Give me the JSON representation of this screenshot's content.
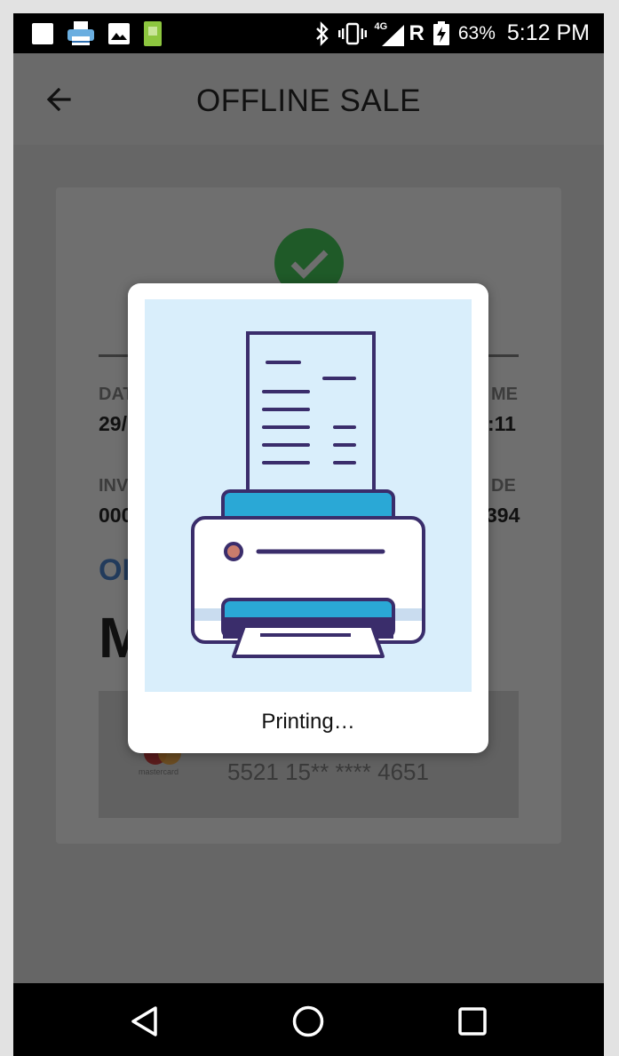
{
  "status_bar": {
    "battery_percent": "63%",
    "time": "5:12 PM",
    "network_label": "4G",
    "roaming_label": "R",
    "left_icons": [
      "notification-square-icon",
      "printer-notification-icon",
      "image-notification-icon",
      "app-notification-icon"
    ],
    "right_icons": [
      "bluetooth-icon",
      "vibrate-icon",
      "signal-icon",
      "battery-charging-icon"
    ]
  },
  "app_bar": {
    "title": "OFFLINE SALE",
    "back_icon": "arrow-left-icon"
  },
  "receipt": {
    "date_label": "DAT",
    "date_value": "29/",
    "time_label": "ME",
    "time_value": ":11",
    "invoice_label": "INV",
    "invoice_value": "000",
    "code_label": "DE",
    "code_value": "394",
    "type_partial": "OI",
    "amount_partial": "M",
    "card_brand": "mastercard",
    "card_number": "5521 15** **** 4651"
  },
  "dialog": {
    "message": "Printing…",
    "illustration": "printer-printing-receipt-icon"
  },
  "nav_bar": {
    "buttons": [
      "back-triangle-icon",
      "home-circle-icon",
      "recents-square-icon"
    ]
  },
  "colors": {
    "accent_dark": "#3a2d6b",
    "printer_blue": "#2aa8d6",
    "success_green": "#1f5a28"
  }
}
